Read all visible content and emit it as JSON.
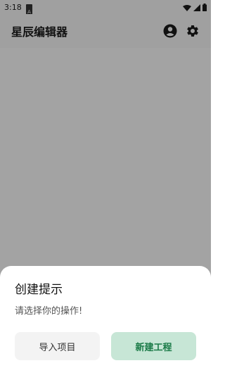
{
  "status_bar": {
    "time": "3:18",
    "icons": [
      "notification-a-icon",
      "wifi-icon",
      "signal-icon",
      "battery-icon"
    ]
  },
  "app_bar": {
    "title": "星辰编辑器",
    "actions": [
      "account-icon",
      "settings-gear-icon"
    ]
  },
  "dialog": {
    "title": "创建提示",
    "message": "请选择你的操作!",
    "import_label": "导入项目",
    "new_label": "新建工程"
  },
  "colors": {
    "scrim": "#a3a3a3",
    "sheet_bg": "#ffffff",
    "primary_button_bg": "#c7e6d6",
    "primary_button_text": "#1a7a47",
    "secondary_button_bg": "#f3f3f3"
  }
}
